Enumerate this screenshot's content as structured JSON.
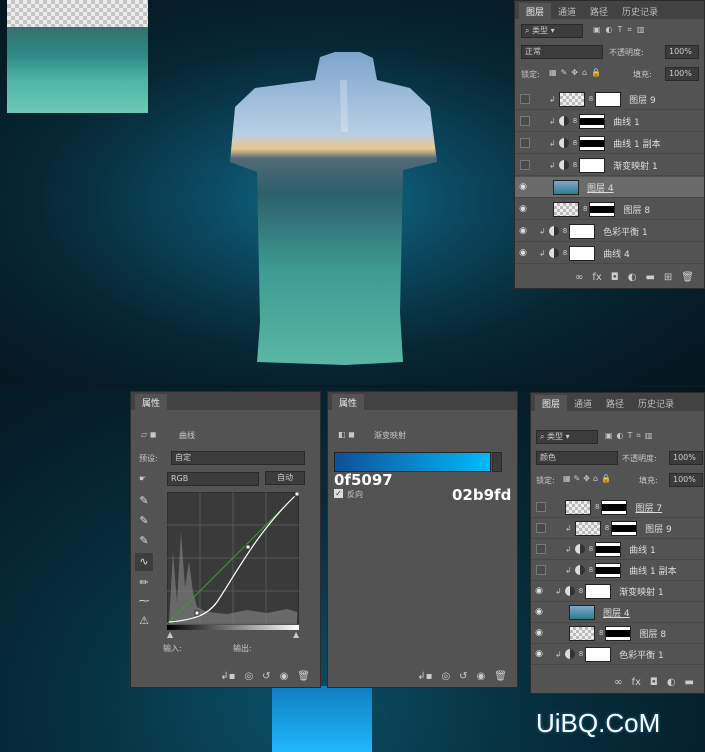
{
  "layers_top": {
    "tabs": [
      "图层",
      "通道",
      "路径",
      "历史记录"
    ],
    "filter_kind": "类型",
    "blend_mode": "正常",
    "opacity_label": "不透明度:",
    "opacity_value": "100%",
    "lock_label": "锁定:",
    "fill_label": "填充:",
    "fill_value": "100%",
    "layers": [
      {
        "name": "图层 9",
        "visible": false
      },
      {
        "name": "曲线 1",
        "visible": false
      },
      {
        "name": "曲线 1 副本",
        "visible": false
      },
      {
        "name": "渐变映射 1",
        "visible": false
      },
      {
        "name": "图层 4",
        "visible": true
      },
      {
        "name": "图层 8",
        "visible": true
      },
      {
        "name": "色彩平衡 1",
        "visible": true
      },
      {
        "name": "曲线 4",
        "visible": true
      }
    ]
  },
  "curves": {
    "tab": "属性",
    "title": "曲线",
    "preset_label": "预设:",
    "preset_value": "自定",
    "channel": "RGB",
    "auto_button": "自动",
    "input_label": "输入:",
    "output_label": "输出:"
  },
  "gradient": {
    "tab": "属性",
    "title": "渐变映射",
    "left_hex": "0f5097",
    "right_hex": "02b9fd",
    "reverse_label": "反向",
    "color_left": "#0f5097",
    "color_right": "#02b9fd"
  },
  "layers_bottom": {
    "tabs": [
      "图层",
      "通道",
      "路径",
      "历史记录"
    ],
    "filter_kind": "类型",
    "blend_mode": "颜色",
    "opacity_label": "不透明度:",
    "opacity_value": "100%",
    "lock_label": "锁定:",
    "fill_label": "填充:",
    "fill_value": "100%",
    "layers": [
      {
        "name": "图层 7",
        "visible": false
      },
      {
        "name": "图层 9",
        "visible": false
      },
      {
        "name": "曲线 1",
        "visible": false
      },
      {
        "name": "曲线 1 副本",
        "visible": false
      },
      {
        "name": "渐变映射 1",
        "visible": true
      },
      {
        "name": "图层 4",
        "visible": true
      },
      {
        "name": "图层 8",
        "visible": true
      },
      {
        "name": "色彩平衡 1",
        "visible": true
      }
    ]
  },
  "watermark": "UiBQ.CoM"
}
